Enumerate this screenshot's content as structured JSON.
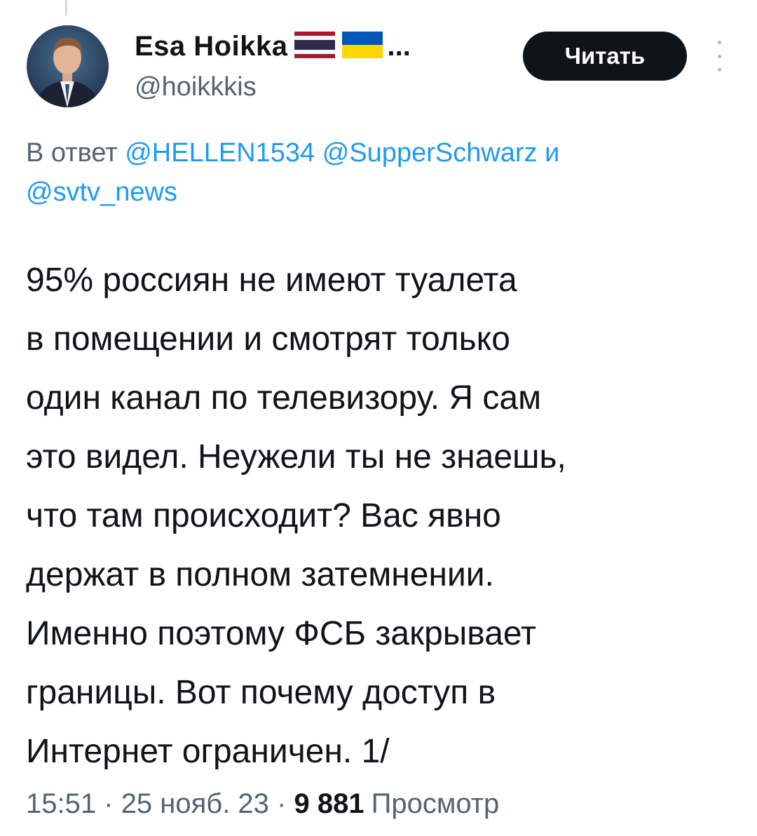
{
  "author": {
    "display_name": "Esa Hoikka",
    "ellipsis": "...",
    "handle": "@hoikkkis",
    "flags": [
      "thailand-flag-icon",
      "ukraine-flag-icon"
    ]
  },
  "actions": {
    "read_label": "Читать"
  },
  "reply": {
    "prefix": "В ответ",
    "mention_1": "@HELLEN1534",
    "mention_2": "@SupperSchwarz",
    "conjunction": "и",
    "mention_3": "@svtv_news"
  },
  "tweet": {
    "lines": [
      "95% россиян не имеют туалета",
      "в помещении и смотрят только",
      "один канал по телевизору. Я сам",
      "это видел. Неужели ты не знаешь,",
      "что там происходит? Вас явно",
      "держат в полном затемнении.",
      "Именно поэтому ФСБ закрывает",
      "границы. Вот почему доступ в",
      "Интернет ограничен. 1/"
    ]
  },
  "meta": {
    "time": "15:51",
    "separator": "·",
    "date": "25 нояб. 23",
    "views_count": "9 881",
    "views_label": "Просмотр"
  },
  "colors": {
    "text": "#0f1419",
    "secondary": "#536471",
    "link": "#1d9bf0",
    "button_bg": "#0f1419"
  }
}
